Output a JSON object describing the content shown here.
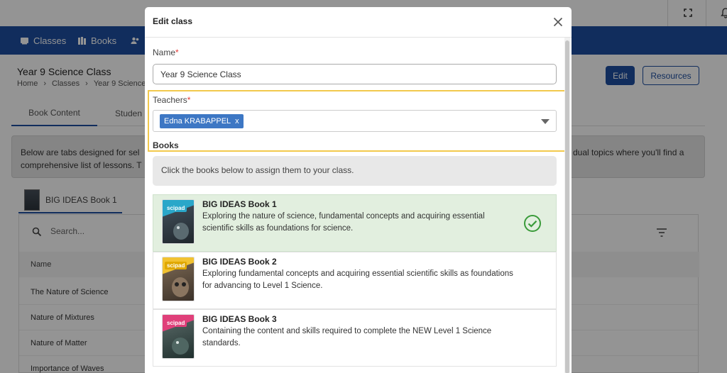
{
  "nav": {
    "items": [
      {
        "label": "Classes",
        "icon": "classes-icon"
      },
      {
        "label": "Books",
        "icon": "books-icon"
      },
      {
        "label": "",
        "icon": "users-icon"
      }
    ]
  },
  "page": {
    "title": "Year 9 Science Class",
    "breadcrumb": [
      "Home",
      "Classes",
      "Year 9 Science"
    ],
    "edit_label": "Edit",
    "resources_label": "Resources",
    "tabs": [
      "Book Content",
      "Studen"
    ],
    "info_line1": "Below are tabs designed for sel",
    "info_line1_right": "dual topics where you'll find a",
    "info_line2": "comprehensive list of lessons. T",
    "book_tab_label": "BIG IDEAS Book 1",
    "search_placeholder": "Search...",
    "table_header": "Name",
    "lessons": [
      "The Nature of Science",
      "Nature of Mixtures",
      "Nature of Matter",
      "Importance of Waves"
    ]
  },
  "modal": {
    "title": "Edit class",
    "name_label": "Name",
    "required_mark": "*",
    "name_value": "Year 9 Science Class",
    "teachers_label": "Teachers",
    "teacher_chip": "Edna KRABAPPEL",
    "chip_remove": "x",
    "books_heading": "Books",
    "books_hint": "Click the books below to assign them to your class.",
    "books": [
      {
        "title": "BIG IDEAS Book 1",
        "desc": "Exploring the nature of science, fundamental concepts and acquiring essential scientific skills as foundations for science.",
        "selected": true,
        "accent": "#2aa7c9"
      },
      {
        "title": "BIG IDEAS Book 2",
        "desc": "Exploring fundamental concepts and acquiring essential scientific skills as foundations for advancing to Level 1 Science.",
        "selected": false,
        "accent": "#f2c230"
      },
      {
        "title": "BIG IDEAS Book 3",
        "desc": "Containing the content and skills required to complete the NEW Level 1 Science standards.",
        "selected": false,
        "accent": "#e0407a"
      }
    ],
    "cover_logo": "scipad"
  },
  "colors": {
    "brand": "#1e4fa0",
    "highlight": "#f2c94c",
    "selected_bg": "#e2efdf",
    "check": "#3a9b3a",
    "required": "#e53935"
  }
}
